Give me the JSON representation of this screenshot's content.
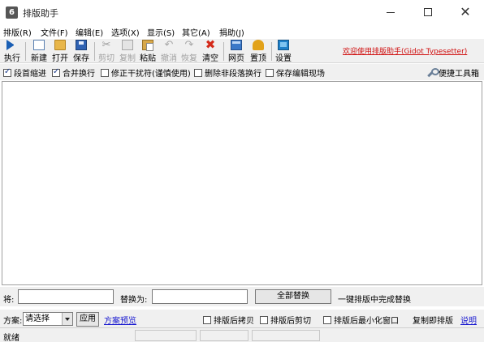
{
  "window": {
    "title": "排版助手",
    "icon_glyph": "6",
    "icon": "app-icon",
    "controls": {
      "close_glyph": "✕"
    }
  },
  "menu": [
    "排版(R)",
    "文件(F)",
    "编辑(E)",
    "选项(X)",
    "显示(S)",
    "其它(A)",
    "捐助(J)"
  ],
  "toolbar": {
    "run": "执行",
    "new": "新建",
    "open": "打开",
    "save": "保存",
    "cut": "剪切",
    "copy": "复制",
    "paste": "粘贴",
    "undo": "撤消",
    "redo": "恢复",
    "clear": "清空",
    "web": "网页",
    "top": "置顶",
    "settings": "设置",
    "welcome": "欢迎使用排版助手(Gidot Typesetter)",
    "glyphs": {
      "cut": "✂",
      "undo": "↶",
      "redo": "↷",
      "clear": "✖"
    }
  },
  "options": [
    {
      "label": "段首缩进",
      "checked": true
    },
    {
      "label": "合并换行",
      "checked": true
    },
    {
      "label": "修正干扰符(谨慎使用)",
      "checked": false
    },
    {
      "label": "删除非段落换行",
      "checked": false
    },
    {
      "label": "保存编辑现场",
      "checked": false
    }
  ],
  "tools_link": "便捷工具箱",
  "editor": {
    "content": ""
  },
  "find": {
    "find_label": "将:",
    "find_value": "",
    "replace_label": "替换为:",
    "replace_value": "",
    "replace_all_button": "全部替换",
    "note": "一键排版中完成替换"
  },
  "plan": {
    "label": "方案:",
    "selected": "请选择",
    "apply_button": "应用",
    "preview_link": "方案预览",
    "options": [
      {
        "label": "排版后拷贝",
        "checked": false
      },
      {
        "label": "排版后剪切",
        "checked": false
      },
      {
        "label": "排版后最小化窗口",
        "checked": false
      }
    ],
    "copy_note": "复制即排版",
    "help_link": "说明"
  },
  "status": {
    "text": "就绪"
  }
}
